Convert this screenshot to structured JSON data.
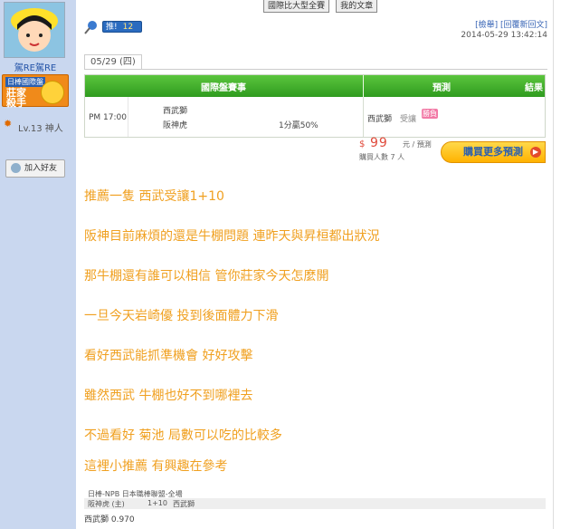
{
  "sidebar": {
    "username": "駕RE駕RE",
    "badge_top": "日棒國際盤",
    "badge_main": "莊家殺手",
    "level": "Lv.13 神人",
    "add_friend": "加入好友"
  },
  "header": {
    "top_buttons": [
      "國際比大型全賽",
      "我的文章"
    ],
    "push_label": "推!",
    "push_count": "12",
    "links": "[檢舉] [回覆新回文]",
    "timestamp": "2014-05-29 13:42:14"
  },
  "match": {
    "date_tab": "05/29 (四)",
    "col_event": "國際盤賽事",
    "col_predict": "預測",
    "col_result": "結果",
    "time": "PM 17:00",
    "team_home": "西武獅",
    "team_away": "阪神虎",
    "handicap": "1分贏50%",
    "pick_team": "西武獅",
    "pick_type": "受讓",
    "result_tag": "勝負"
  },
  "purchase": {
    "currency": "$",
    "price": "99",
    "unit": "元 / 預測",
    "buyers": "購買人數 7 人",
    "button": "購買更多預測"
  },
  "post": {
    "lines": [
      "推薦一隻 西武受讓1+10",
      "阪神目前麻煩的還是牛棚問題  連昨天與昇桓都出狀況",
      "那牛棚還有誰可以相信 管你莊家今天怎麼開",
      "一旦今天岩崎優 投到後面體力下滑",
      "看好西武能抓準機會 好好攻擊",
      "雖然西武 牛棚也好不到哪裡去",
      "不過看好 菊池 局數可以吃的比較多",
      "這裡小推薦  有興趣在參考"
    ]
  },
  "footer": {
    "league": "日棒-NPB 日本職棒聯盟-全場",
    "team_line": "阪神虎 (主)",
    "spread": "1+10",
    "away": "西武獅",
    "odds": "西武獅 0.970"
  }
}
